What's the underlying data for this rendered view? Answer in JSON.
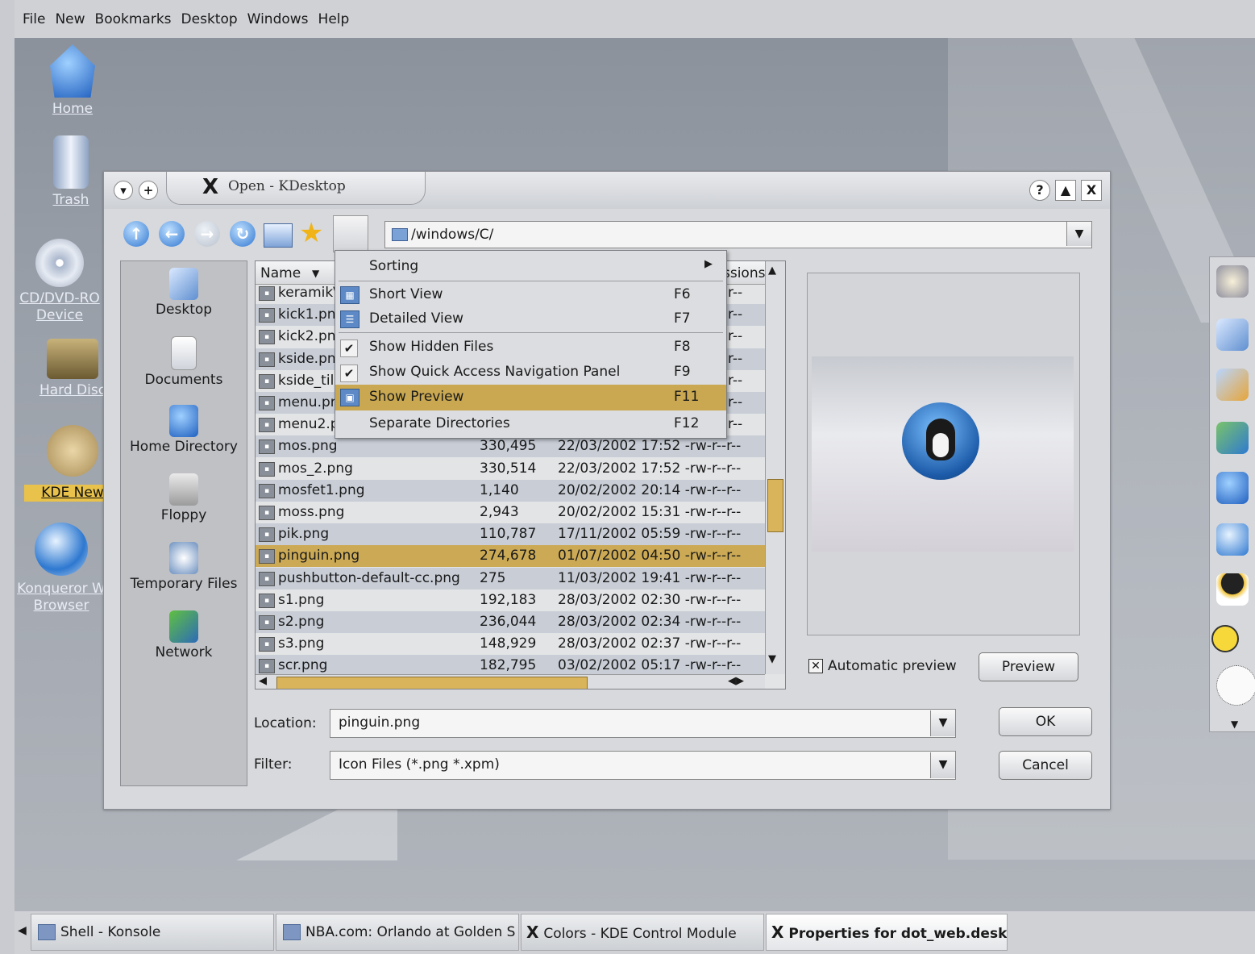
{
  "menubar": [
    "File",
    "New",
    "Bookmarks",
    "Desktop",
    "Windows",
    "Help"
  ],
  "desktop_icons": [
    {
      "label": "Home",
      "icon": "home-icon"
    },
    {
      "label": "Trash",
      "icon": "trash-icon"
    },
    {
      "label": "CD/DVD-RO",
      "label2": "Device",
      "icon": "cdrom-icon"
    },
    {
      "label": "Hard Disc",
      "icon": "harddisk-icon"
    },
    {
      "label": "KDE New",
      "icon": "kde-news-icon"
    },
    {
      "label": "Konqueror W",
      "label2": "Browser",
      "icon": "konqueror-icon"
    }
  ],
  "dialog": {
    "title": "Open - KDesktop",
    "help_button": "?",
    "max_button": "▲",
    "close_button": "X",
    "path": "/windows/C/",
    "toolbar": [
      "up-icon",
      "back-icon",
      "forward-icon",
      "reload-icon",
      "new-folder-icon",
      "bookmark-icon",
      "configure-icon"
    ]
  },
  "quick_access": [
    {
      "label": "Desktop",
      "icon": "desktop-icon"
    },
    {
      "label": "Documents",
      "icon": "documents-icon"
    },
    {
      "label": "Home Directory",
      "icon": "home-directory-icon"
    },
    {
      "label": "Floppy",
      "icon": "floppy-icon"
    },
    {
      "label": "Temporary Files",
      "icon": "temporary-files-icon"
    },
    {
      "label": "Network",
      "icon": "network-icon"
    }
  ],
  "file_header": {
    "name": "Name",
    "permissions": "ssions"
  },
  "files": [
    {
      "name": "keramik\\",
      "size": "",
      "date": "",
      "perm": "r--"
    },
    {
      "name": "kick1.pn",
      "size": "",
      "date": "",
      "perm": "r--"
    },
    {
      "name": "kick2.pn",
      "size": "",
      "date": "",
      "perm": "r--"
    },
    {
      "name": "kside.pn",
      "size": "",
      "date": "",
      "perm": "r--"
    },
    {
      "name": "kside_til",
      "size": "",
      "date": "",
      "perm": "r--"
    },
    {
      "name": "menu.pr",
      "size": "",
      "date": "",
      "perm": "r--"
    },
    {
      "name": "menu2.p",
      "size": "",
      "date": "",
      "perm": "r--"
    },
    {
      "name": "mos.png",
      "size": "330,495",
      "date": "22/03/2002 17:52 -rw-r--r--",
      "perm": ""
    },
    {
      "name": "mos_2.png",
      "size": "330,514",
      "date": "22/03/2002 17:52 -rw-r--r--",
      "perm": ""
    },
    {
      "name": "mosfet1.png",
      "size": "1,140",
      "date": "20/02/2002 20:14 -rw-r--r--",
      "perm": ""
    },
    {
      "name": "moss.png",
      "size": "2,943",
      "date": "20/02/2002 15:31 -rw-r--r--",
      "perm": ""
    },
    {
      "name": "pik.png",
      "size": "110,787",
      "date": "17/11/2002 05:59 -rw-r--r--",
      "perm": ""
    },
    {
      "name": "pinguin.png",
      "size": "274,678",
      "date": "01/07/2002 04:50 -rw-r--r--",
      "perm": ""
    },
    {
      "name": "pushbutton-default-cc.png",
      "size": "275",
      "date": "11/03/2002 19:41 -rw-r--r--",
      "perm": ""
    },
    {
      "name": "s1.png",
      "size": "192,183",
      "date": "28/03/2002 02:30 -rw-r--r--",
      "perm": ""
    },
    {
      "name": "s2.png",
      "size": "236,044",
      "date": "28/03/2002 02:34 -rw-r--r--",
      "perm": ""
    },
    {
      "name": "s3.png",
      "size": "148,929",
      "date": "28/03/2002 02:37 -rw-r--r--",
      "perm": ""
    },
    {
      "name": "scr.png",
      "size": "182,795",
      "date": "03/02/2002 05:17 -rw-r--r--",
      "perm": ""
    }
  ],
  "selected_file": "pinguin.png",
  "context_menu": {
    "sorting": "Sorting",
    "short_view": {
      "label": "Short View",
      "key": "F6"
    },
    "detailed_view": {
      "label": "Detailed View",
      "key": "F7"
    },
    "hidden_files": {
      "label": "Show Hidden Files",
      "key": "F8"
    },
    "quick_panel": {
      "label": "Show Quick Access Navigation Panel",
      "key": "F9"
    },
    "show_preview": {
      "label": "Show Preview",
      "key": "F11"
    },
    "separate_dirs": {
      "label": "Separate Directories",
      "key": "F12"
    }
  },
  "preview": {
    "auto_label": "Automatic preview",
    "button": "Preview"
  },
  "form": {
    "location_label": "Location:",
    "location_value": "pinguin.png",
    "filter_label": "Filter:",
    "filter_value": "Icon Files (*.png *.xpm)",
    "ok": "OK",
    "cancel": "Cancel"
  },
  "taskbar": [
    "Shell - Konsole",
    "NBA.com: Orlando at Golden S",
    "Colors - KDE Control Module",
    "Properties for dot_web.deskt"
  ],
  "colors": {
    "selection": "#ccaa55",
    "menu_highlight": "#c9a851",
    "accent": "#2f76d0"
  }
}
